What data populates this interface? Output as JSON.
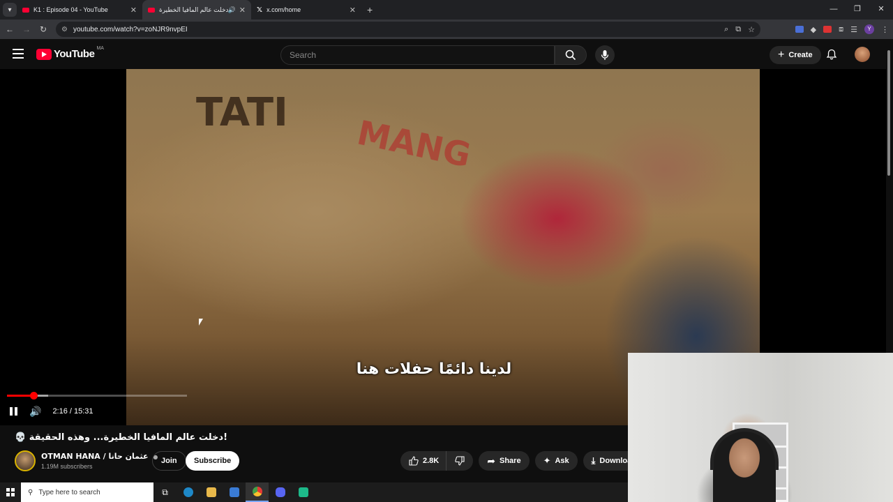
{
  "browser": {
    "tabs": [
      {
        "label": "K1 : Episode 04 - YouTube",
        "active": false
      },
      {
        "label": "دخلت عالم المافيا الخطيرة...",
        "active": true
      },
      {
        "label": "x.com/home",
        "active": false
      }
    ],
    "url": "youtube.com/watch?v=zoNJR9nvpEI"
  },
  "header": {
    "logo_text": "YouTube",
    "country_code": "MA",
    "search_placeholder": "Search",
    "create_label": "Create"
  },
  "player": {
    "subtitle": "لدينا دائمًا حفلات هنا",
    "time_display": "2:16 / 15:31",
    "progress_fraction": 0.146,
    "buffered_fraction": 0.23,
    "graffiti": [
      "TATI",
      "MANG"
    ]
  },
  "video": {
    "title": "💀 دخلت عالم المافيا الخطيرة... وهذه الحقيقة!",
    "channel_name": "OTMAN HANA / عثمان حانا",
    "verified_mark": "●",
    "subscribers": "1.19M subscribers",
    "join_label": "Join",
    "subscribe_label": "Subscribe",
    "likes": "2.8K",
    "share_label": "Share",
    "ask_label": "Ask",
    "download_label": "Download"
  },
  "taskbar": {
    "search_placeholder": "Type here to search"
  },
  "colors": {
    "accent_red": "#ff0000",
    "background": "#0f0f0f"
  }
}
